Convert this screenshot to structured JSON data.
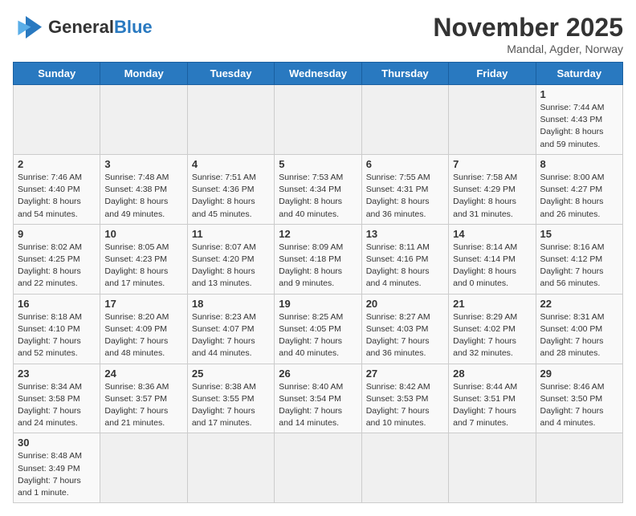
{
  "header": {
    "logo_general": "General",
    "logo_blue": "Blue",
    "month_title": "November 2025",
    "subtitle": "Mandal, Agder, Norway"
  },
  "days_of_week": [
    "Sunday",
    "Monday",
    "Tuesday",
    "Wednesday",
    "Thursday",
    "Friday",
    "Saturday"
  ],
  "weeks": [
    [
      {
        "day": "",
        "info": ""
      },
      {
        "day": "",
        "info": ""
      },
      {
        "day": "",
        "info": ""
      },
      {
        "day": "",
        "info": ""
      },
      {
        "day": "",
        "info": ""
      },
      {
        "day": "",
        "info": ""
      },
      {
        "day": "1",
        "info": "Sunrise: 7:44 AM\nSunset: 4:43 PM\nDaylight: 8 hours\nand 59 minutes."
      }
    ],
    [
      {
        "day": "2",
        "info": "Sunrise: 7:46 AM\nSunset: 4:40 PM\nDaylight: 8 hours\nand 54 minutes."
      },
      {
        "day": "3",
        "info": "Sunrise: 7:48 AM\nSunset: 4:38 PM\nDaylight: 8 hours\nand 49 minutes."
      },
      {
        "day": "4",
        "info": "Sunrise: 7:51 AM\nSunset: 4:36 PM\nDaylight: 8 hours\nand 45 minutes."
      },
      {
        "day": "5",
        "info": "Sunrise: 7:53 AM\nSunset: 4:34 PM\nDaylight: 8 hours\nand 40 minutes."
      },
      {
        "day": "6",
        "info": "Sunrise: 7:55 AM\nSunset: 4:31 PM\nDaylight: 8 hours\nand 36 minutes."
      },
      {
        "day": "7",
        "info": "Sunrise: 7:58 AM\nSunset: 4:29 PM\nDaylight: 8 hours\nand 31 minutes."
      },
      {
        "day": "8",
        "info": "Sunrise: 8:00 AM\nSunset: 4:27 PM\nDaylight: 8 hours\nand 26 minutes."
      }
    ],
    [
      {
        "day": "9",
        "info": "Sunrise: 8:02 AM\nSunset: 4:25 PM\nDaylight: 8 hours\nand 22 minutes."
      },
      {
        "day": "10",
        "info": "Sunrise: 8:05 AM\nSunset: 4:23 PM\nDaylight: 8 hours\nand 17 minutes."
      },
      {
        "day": "11",
        "info": "Sunrise: 8:07 AM\nSunset: 4:20 PM\nDaylight: 8 hours\nand 13 minutes."
      },
      {
        "day": "12",
        "info": "Sunrise: 8:09 AM\nSunset: 4:18 PM\nDaylight: 8 hours\nand 9 minutes."
      },
      {
        "day": "13",
        "info": "Sunrise: 8:11 AM\nSunset: 4:16 PM\nDaylight: 8 hours\nand 4 minutes."
      },
      {
        "day": "14",
        "info": "Sunrise: 8:14 AM\nSunset: 4:14 PM\nDaylight: 8 hours\nand 0 minutes."
      },
      {
        "day": "15",
        "info": "Sunrise: 8:16 AM\nSunset: 4:12 PM\nDaylight: 7 hours\nand 56 minutes."
      }
    ],
    [
      {
        "day": "16",
        "info": "Sunrise: 8:18 AM\nSunset: 4:10 PM\nDaylight: 7 hours\nand 52 minutes."
      },
      {
        "day": "17",
        "info": "Sunrise: 8:20 AM\nSunset: 4:09 PM\nDaylight: 7 hours\nand 48 minutes."
      },
      {
        "day": "18",
        "info": "Sunrise: 8:23 AM\nSunset: 4:07 PM\nDaylight: 7 hours\nand 44 minutes."
      },
      {
        "day": "19",
        "info": "Sunrise: 8:25 AM\nSunset: 4:05 PM\nDaylight: 7 hours\nand 40 minutes."
      },
      {
        "day": "20",
        "info": "Sunrise: 8:27 AM\nSunset: 4:03 PM\nDaylight: 7 hours\nand 36 minutes."
      },
      {
        "day": "21",
        "info": "Sunrise: 8:29 AM\nSunset: 4:02 PM\nDaylight: 7 hours\nand 32 minutes."
      },
      {
        "day": "22",
        "info": "Sunrise: 8:31 AM\nSunset: 4:00 PM\nDaylight: 7 hours\nand 28 minutes."
      }
    ],
    [
      {
        "day": "23",
        "info": "Sunrise: 8:34 AM\nSunset: 3:58 PM\nDaylight: 7 hours\nand 24 minutes."
      },
      {
        "day": "24",
        "info": "Sunrise: 8:36 AM\nSunset: 3:57 PM\nDaylight: 7 hours\nand 21 minutes."
      },
      {
        "day": "25",
        "info": "Sunrise: 8:38 AM\nSunset: 3:55 PM\nDaylight: 7 hours\nand 17 minutes."
      },
      {
        "day": "26",
        "info": "Sunrise: 8:40 AM\nSunset: 3:54 PM\nDaylight: 7 hours\nand 14 minutes."
      },
      {
        "day": "27",
        "info": "Sunrise: 8:42 AM\nSunset: 3:53 PM\nDaylight: 7 hours\nand 10 minutes."
      },
      {
        "day": "28",
        "info": "Sunrise: 8:44 AM\nSunset: 3:51 PM\nDaylight: 7 hours\nand 7 minutes."
      },
      {
        "day": "29",
        "info": "Sunrise: 8:46 AM\nSunset: 3:50 PM\nDaylight: 7 hours\nand 4 minutes."
      }
    ],
    [
      {
        "day": "30",
        "info": "Sunrise: 8:48 AM\nSunset: 3:49 PM\nDaylight: 7 hours\nand 1 minute."
      },
      {
        "day": "",
        "info": ""
      },
      {
        "day": "",
        "info": ""
      },
      {
        "day": "",
        "info": ""
      },
      {
        "day": "",
        "info": ""
      },
      {
        "day": "",
        "info": ""
      },
      {
        "day": "",
        "info": ""
      }
    ]
  ]
}
